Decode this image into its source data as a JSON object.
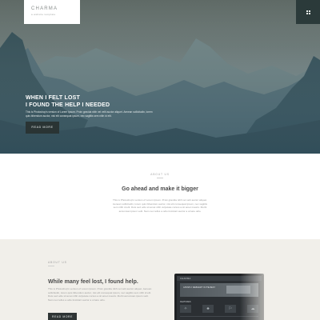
{
  "brand": {
    "name": "CHARMA",
    "tagline": "a website template"
  },
  "hero": {
    "heading_line1": "WHEN I FELT LOST",
    "heading_line2": "I FOUND THE HELP I NEEDED",
    "text": "This is Photoshop's version of Lorem Ipsum. Proin gravida nibh vel velit auctor aliquet. Aenean sollicitudin, lorem quis bibendum auctor, nisi elit consequat ipsum, nec sagittis sem nibh id elit.",
    "button_label": "READ MORE"
  },
  "about": {
    "label": "ABOUT US",
    "heading": "Go ahead and make it bigger",
    "text": "This is Photoshop's version of Lorem Ipsum. Proin gravida nibh vel velit auctor aliquet. Aenean sollicitudin, lorem quis bibendum auctor, nisi elit consequat ipsum, nec sagittis sem nibh id elit. Duis sed odio sit amet nibh vulputate cursus a sit amet mauris. Morbi accumsan ipsum velit. Nam nec tellus a odio tincidunt auctor a ornare odio."
  },
  "section2": {
    "label": "ABOUT US",
    "heading": "While many feel lost, I found help.",
    "text": "This is Photoshop's version of Lorem Ipsum. Proin gravida nibh vel velit auctor aliquet. Aenean sollicitudin, lorem quis bibendum auctor, nisi elit consequat ipsum, nec sagittis sem nibh id elit. Duis sed odio sit amet nibh vulputate cursus a sit amet mauris. Morbi accumsan ipsum velit. Nam nec tellus a odio tincidunt auctor a ornare odio.",
    "button_label": "READ MORE"
  },
  "device_screen": {
    "logo": "CHARMA",
    "caption": "GHOSTLY WEBSIGHT IS THE BEST",
    "title": "FEATURES",
    "icons": [
      "✧",
      "♣",
      "⚐",
      "☁"
    ]
  },
  "icons": {
    "menu": "grid-icon"
  },
  "colors": {
    "hero_dark": "#2a3434",
    "section2_bg": "#f1efea",
    "menu_bg": "#2b3a3a"
  }
}
